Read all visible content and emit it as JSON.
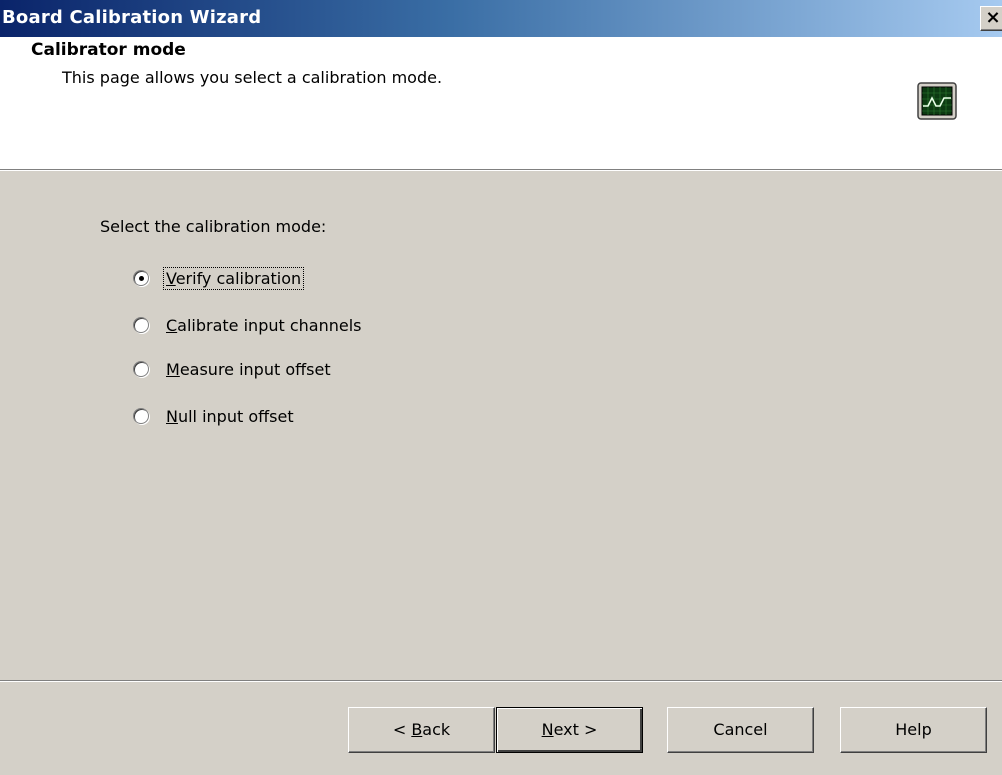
{
  "window": {
    "title": "Board Calibration Wizard",
    "close_label": "×"
  },
  "header": {
    "title": "Calibrator mode",
    "subtitle": "This page allows you select a calibration mode.",
    "icon": "oscilloscope-icon"
  },
  "body": {
    "prompt": "Select the calibration mode:",
    "options": [
      {
        "mnemonic": "V",
        "rest": "erify calibration",
        "selected": true
      },
      {
        "mnemonic": "C",
        "rest": "alibrate input channels",
        "selected": false
      },
      {
        "mnemonic": "M",
        "rest": "easure input offset",
        "selected": false
      },
      {
        "mnemonic": "N",
        "rest": "ull input offset",
        "selected": false
      }
    ]
  },
  "buttons": {
    "back": {
      "pre": "< ",
      "mnemonic": "B",
      "rest": "ack"
    },
    "next": {
      "pre": "",
      "mnemonic": "N",
      "rest": "ext >"
    },
    "cancel": "Cancel",
    "help": "Help"
  },
  "colors": {
    "title_gradient_start": "#0a246a",
    "title_gradient_end": "#a6caf0",
    "face": "#d4d0c8",
    "scope_screen": "#0c3a12",
    "scope_trace": "#e8ffe8"
  }
}
